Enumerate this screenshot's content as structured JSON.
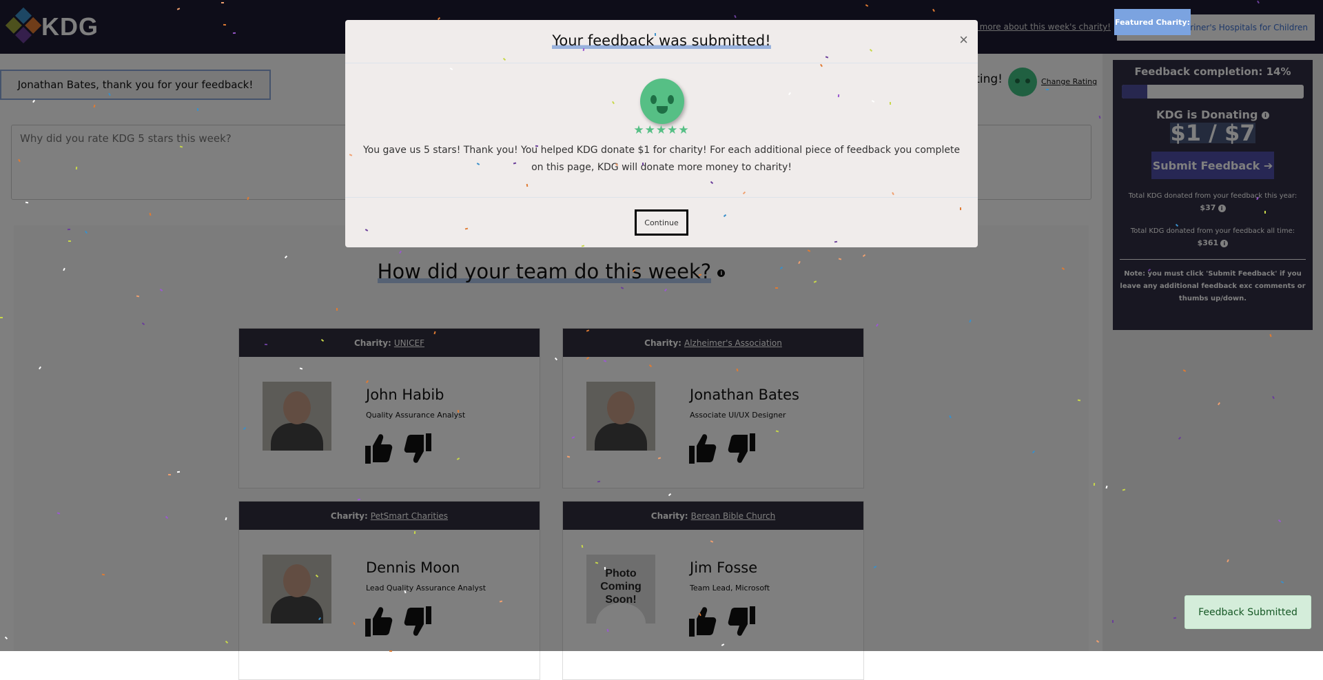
{
  "header": {
    "logo_text": "KDG",
    "learn_link": "Learn more about this week's charity!",
    "featured_label": "Featured Charity:",
    "featured_value": "Shriner's Hospitals for Children"
  },
  "thanks_message": "Jonathan Bates, thank you for your feedback!",
  "rating": {
    "text": "ating!",
    "change_label": "Change Rating"
  },
  "comment": {
    "placeholder": "Why did you rate KDG 5 stars this week?",
    "value": ""
  },
  "team_heading": "How did your team do this week?",
  "team": [
    {
      "charity_label": "Charity:",
      "charity": "UNICEF",
      "name": "John Habib",
      "title": "Quality Assurance Analyst",
      "photo": "photo"
    },
    {
      "charity_label": "Charity:",
      "charity": "Alzheimer's Association",
      "name": "Jonathan Bates",
      "title": "Associate UI/UX Designer",
      "photo": "photo"
    },
    {
      "charity_label": "Charity:",
      "charity": "PetSmart Charities",
      "name": "Dennis Moon",
      "title": "Lead Quality Assurance Analyst",
      "photo": "photo"
    },
    {
      "charity_label": "Charity:",
      "charity": "Berean Bible Church",
      "name": "Jim Fosse",
      "title": "Team Lead, Microsoft",
      "photo": "Photo Coming Soon!"
    }
  ],
  "sidebar": {
    "completion_label": "Feedback completion: 14%",
    "completion_percent": 14,
    "donating_label": "KDG is Donating",
    "donating_amount": "$1 / $7",
    "submit_label": "Submit Feedback ➔",
    "year_label": "Total KDG donated from your feedback this year:",
    "year_value": "$37",
    "alltime_label": "Total KDG donated from your feedback all time:",
    "alltime_value": "$361",
    "note": "Note: you must click 'Submit Feedback' if you leave any additional feedback exc comments or thumbs up/down."
  },
  "modal": {
    "title": "Your feedback was submitted!",
    "close": "×",
    "stars": "★★★★★",
    "message": "You gave us 5 stars! Thank you! You helped KDG donate $1 for charity! For each additional piece of feedback you complete on this page, KDG will donate more money to charity!",
    "continue_label": "Continue"
  },
  "toast": "Feedback Submitted",
  "colors": {
    "accent": "#4f4fa8",
    "header": "#1d1b33",
    "success": "#56bf85",
    "toast_bg": "#d4edda"
  }
}
